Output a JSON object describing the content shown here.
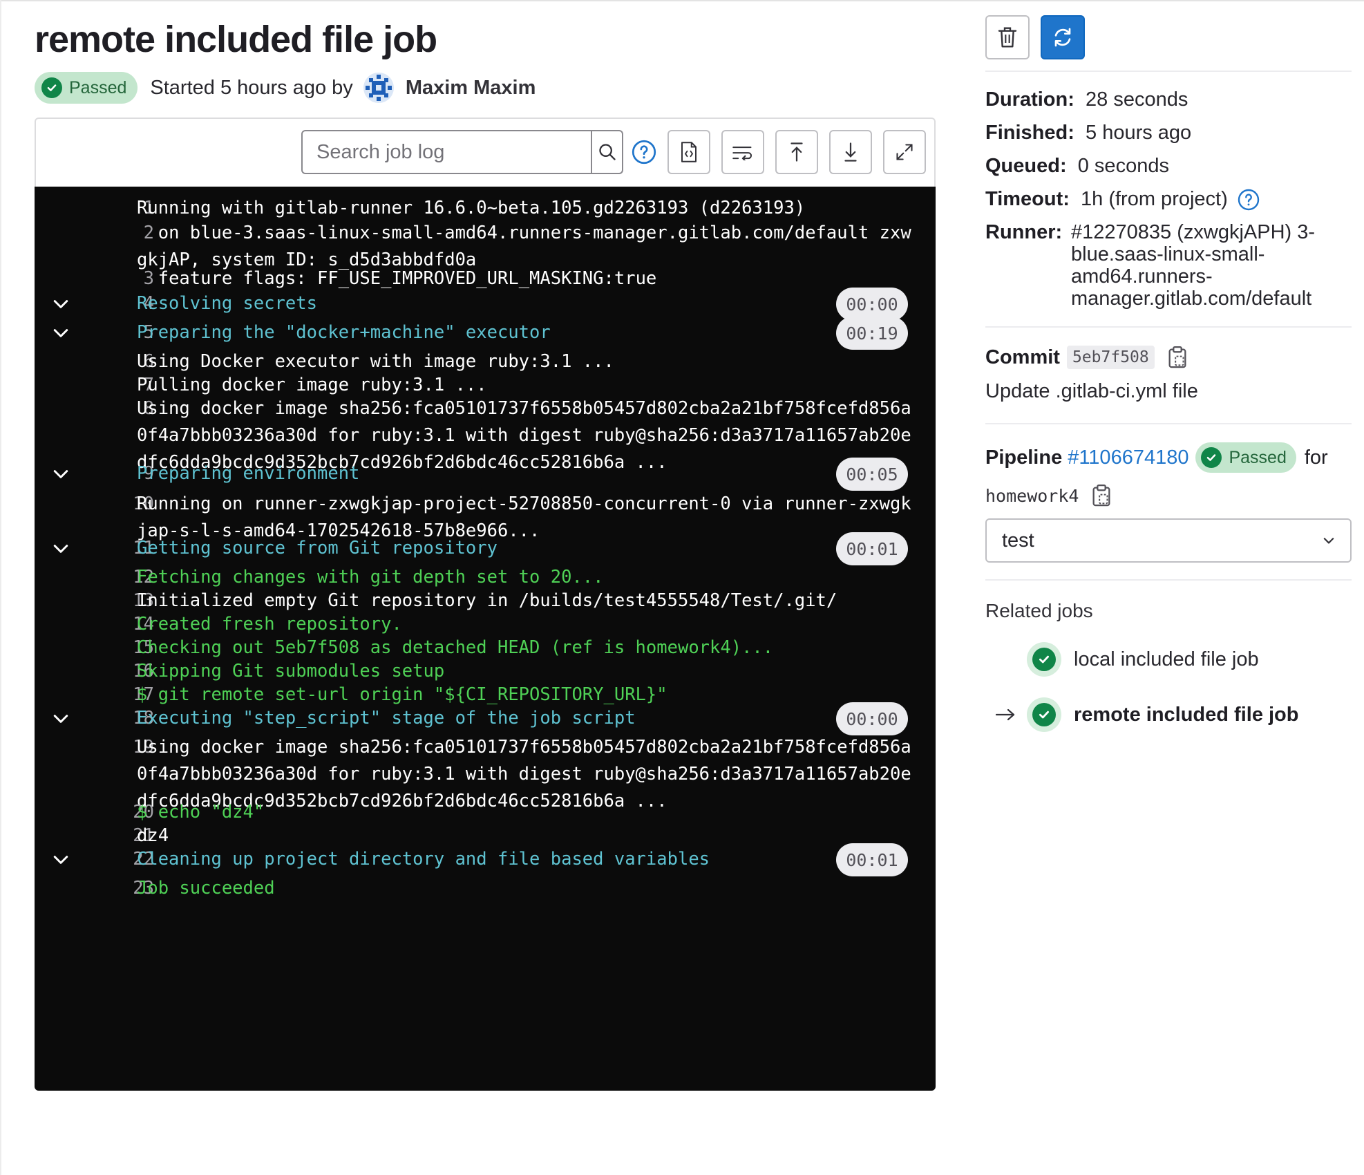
{
  "job": {
    "title": "remote included file job",
    "status": "Passed",
    "started_text": "Started 5 hours ago by",
    "author": "Maxim Maxim"
  },
  "toolbar": {
    "search_placeholder": "Search job log"
  },
  "log": [
    {
      "n": "1",
      "text": "Running with gitlab-runner 16.6.0~beta.105.gd2263193 (d2263193)",
      "color": "white"
    },
    {
      "n": "2",
      "text": "  on blue-3.saas-linux-small-amd64.runners-manager.gitlab.com/default zxwgkjAP, system ID: s_d5d3abbdfd0a",
      "color": "white"
    },
    {
      "n": "3",
      "text": "  feature flags: FF_USE_IMPROVED_URL_MASKING:true",
      "color": "white"
    },
    {
      "n": "4",
      "text": "Resolving secrets",
      "color": "cyan",
      "section": true,
      "duration": "00:00"
    },
    {
      "n": "5",
      "text": "Preparing the \"docker+machine\" executor",
      "color": "cyan",
      "section": true,
      "duration": "00:19"
    },
    {
      "n": "6",
      "text": "Using Docker executor with image ruby:3.1 ...",
      "color": "white"
    },
    {
      "n": "7",
      "text": "Pulling docker image ruby:3.1 ...",
      "color": "white"
    },
    {
      "n": "8",
      "text": "Using docker image sha256:fca05101737f6558b05457d802cba2a21bf758fcefd856a0f4a7bbb03236a30d for ruby:3.1 with digest ruby@sha256:d3a3717a11657ab20edfc6dda9bcdc9d352bcb7cd926bf2d6bdc46cc52816b6a ...",
      "color": "white"
    },
    {
      "n": "9",
      "text": "Preparing environment",
      "color": "cyan",
      "section": true,
      "duration": "00:05"
    },
    {
      "n": "10",
      "text": "Running on runner-zxwgkjap-project-52708850-concurrent-0 via runner-zxwgkjap-s-l-s-amd64-1702542618-57b8e966...",
      "color": "white"
    },
    {
      "n": "11",
      "text": "Getting source from Git repository",
      "color": "cyan",
      "section": true,
      "duration": "00:01"
    },
    {
      "n": "12",
      "text": "Fetching changes with git depth set to 20...",
      "color": "green"
    },
    {
      "n": "13",
      "text": "Initialized empty Git repository in /builds/test4555548/Test/.git/",
      "color": "white"
    },
    {
      "n": "14",
      "text": "Created fresh repository.",
      "color": "green"
    },
    {
      "n": "15",
      "text": "Checking out 5eb7f508 as detached HEAD (ref is homework4)...",
      "color": "green"
    },
    {
      "n": "16",
      "text": "Skipping Git submodules setup",
      "color": "green"
    },
    {
      "n": "17",
      "text": "$ git remote set-url origin \"${CI_REPOSITORY_URL}\"",
      "color": "green"
    },
    {
      "n": "18",
      "text": "Executing \"step_script\" stage of the job script",
      "color": "cyan",
      "section": true,
      "duration": "00:00"
    },
    {
      "n": "19",
      "text": "Using docker image sha256:fca05101737f6558b05457d802cba2a21bf758fcefd856a0f4a7bbb03236a30d for ruby:3.1 with digest ruby@sha256:d3a3717a11657ab20edfc6dda9bcdc9d352bcb7cd926bf2d6bdc46cc52816b6a ...",
      "color": "white"
    },
    {
      "n": "20",
      "text": "$ echo \"dz4\"",
      "color": "green"
    },
    {
      "n": "21",
      "text": "dz4",
      "color": "white"
    },
    {
      "n": "22",
      "text": "Cleaning up project directory and file based variables",
      "color": "cyan",
      "section": true,
      "duration": "00:01"
    },
    {
      "n": "23",
      "text": "Job succeeded",
      "color": "green"
    }
  ],
  "sidebar": {
    "duration_label": "Duration:",
    "duration_value": "28 seconds",
    "finished_label": "Finished:",
    "finished_value": "5 hours ago",
    "queued_label": "Queued:",
    "queued_value": "0 seconds",
    "timeout_label": "Timeout:",
    "timeout_value": "1h (from project)",
    "runner_label": "Runner:",
    "runner_value": "#12270835 (zxwgkjAPH) 3-blue.saas-linux-small-amd64.runners-manager.gitlab.com/default",
    "commit_label": "Commit",
    "commit_sha": "5eb7f508",
    "commit_message": "Update .gitlab-ci.yml file",
    "pipeline_label": "Pipeline",
    "pipeline_id": "#1106674180",
    "pipeline_status": "Passed",
    "pipeline_for": "for",
    "branch": "homework4",
    "stage_selected": "test",
    "related_title": "Related jobs",
    "related_jobs": [
      "local included file job",
      "remote included file job"
    ]
  },
  "colors": {
    "accent": "#1f75cb",
    "success": "#108548",
    "log_bg": "#0b0b0b",
    "log_cyan": "#5fc3d2",
    "log_green": "#4fd156"
  }
}
